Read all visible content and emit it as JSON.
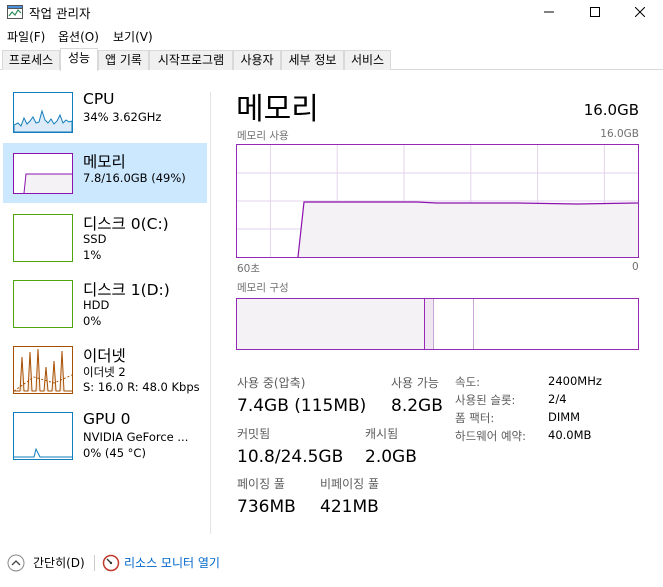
{
  "window": {
    "title": "작업 관리자"
  },
  "menu": [
    "파일(F)",
    "옵션(O)",
    "보기(V)"
  ],
  "tabs": [
    {
      "label": "프로세스",
      "active": false
    },
    {
      "label": "성능",
      "active": true
    },
    {
      "label": "앱 기록",
      "active": false
    },
    {
      "label": "시작프로그램",
      "active": false
    },
    {
      "label": "사용자",
      "active": false
    },
    {
      "label": "세부 정보",
      "active": false
    },
    {
      "label": "서비스",
      "active": false
    }
  ],
  "sidebar": {
    "cpu": {
      "title": "CPU",
      "line1": "34% 3.62GHz",
      "color": "#117dbb"
    },
    "memory": {
      "title": "메모리",
      "line1": "7.8/16.0GB (49%)",
      "color": "#8b12ae"
    },
    "disk0": {
      "title": "디스크 0(C:)",
      "line1": "SSD",
      "line2": "1%",
      "color": "#4da60c"
    },
    "disk1": {
      "title": "디스크 1(D:)",
      "line1": "HDD",
      "line2": "0%",
      "color": "#4da60c"
    },
    "ethernet": {
      "title": "이더넷",
      "line1": "이더넷 2",
      "line2": "S: 16.0  R: 48.0 Kbps",
      "color": "#a74f01"
    },
    "gpu": {
      "title": "GPU 0",
      "line1": "NVIDIA GeForce ...",
      "line2": "0% (45 °C)",
      "color": "#117dbb"
    }
  },
  "main": {
    "title": "메모리",
    "total": "16.0GB",
    "usage_label": "메모리 사용",
    "usage_max": "16.0GB",
    "time_left": "60초",
    "time_right": "0",
    "composition_label": "메모리 구성",
    "accent": "#9528b4"
  },
  "stats": {
    "in_use_label": "사용 중(압축)",
    "in_use_value": "7.4GB (115MB)",
    "available_label": "사용 가능",
    "available_value": "8.2GB",
    "committed_label": "커밋됨",
    "committed_value": "10.8/24.5GB",
    "cached_label": "캐시됨",
    "cached_value": "2.0GB",
    "paged_label": "페이징 풀",
    "paged_value": "736MB",
    "nonpaged_label": "비페이징 풀",
    "nonpaged_value": "421MB"
  },
  "details": [
    {
      "label": "속도:",
      "value": "2400MHz"
    },
    {
      "label": "사용된 슬롯:",
      "value": "2/4"
    },
    {
      "label": "폼 팩터:",
      "value": "DIMM"
    },
    {
      "label": "하드웨어 예약:",
      "value": "40.0MB"
    }
  ],
  "footer": {
    "collapse": "간단히(D)",
    "resource_monitor": "리소스 모니터 열기"
  }
}
